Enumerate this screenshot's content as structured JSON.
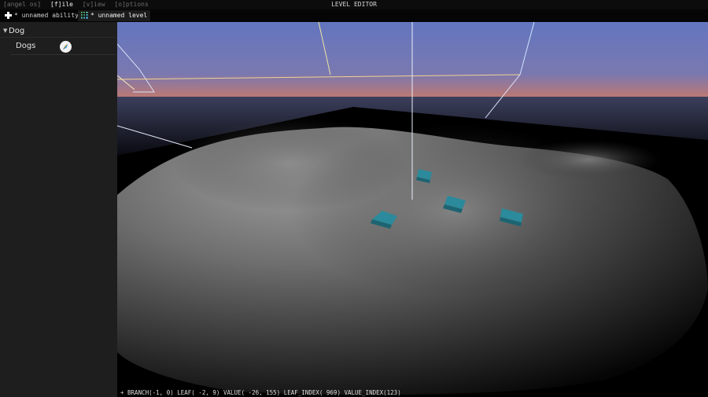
{
  "menubar": {
    "items": [
      "[angel os]",
      "[f]ile",
      "[v]iew",
      "[o]ptions"
    ],
    "title": "LEVEL EDITOR"
  },
  "tabs": [
    {
      "label": "* unnamed ability",
      "icon": "plus-icon"
    },
    {
      "label": "* unnamed level",
      "icon": "grid-level-icon"
    }
  ],
  "sidebar": {
    "group": {
      "label": "Dog",
      "chevron": "chevron-down-icon"
    },
    "items": [
      {
        "label": "Dogs",
        "icon": "compass-icon"
      }
    ]
  },
  "viewport": {
    "status": "+ BRANCH(-1, 0) LEAF( -2,  9) VALUE( -26, 155) LEAF_INDEX( 969) VALUE_INDEX(123)"
  },
  "colors": {
    "sky_top": "#6376bf",
    "sky_horizon": "#c97e62",
    "entity": "#2b8a9b",
    "sidebar_bg": "#1e1e1e"
  }
}
